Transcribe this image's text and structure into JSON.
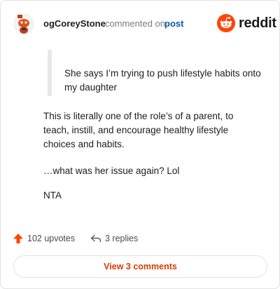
{
  "header": {
    "username": "ogCoreyStone",
    "action_text": "commented on",
    "post_link": "post",
    "logo_text": "reddit"
  },
  "comment": {
    "quote": "She says I’m trying to push lifestyle habits onto my daughter",
    "paragraphs": [
      "This is literally one of the role’s of a parent, to teach, instill, and encourage healthy lifestyle choices and habits.",
      "…what was her issue again? Lol",
      "NTA"
    ]
  },
  "footer": {
    "upvotes": "102 upvotes",
    "replies": "3 replies",
    "view_comments": "View 3 comments"
  },
  "colors": {
    "accent": "#d93a00",
    "upvote": "#ff4500",
    "link": "#0a56b8"
  }
}
